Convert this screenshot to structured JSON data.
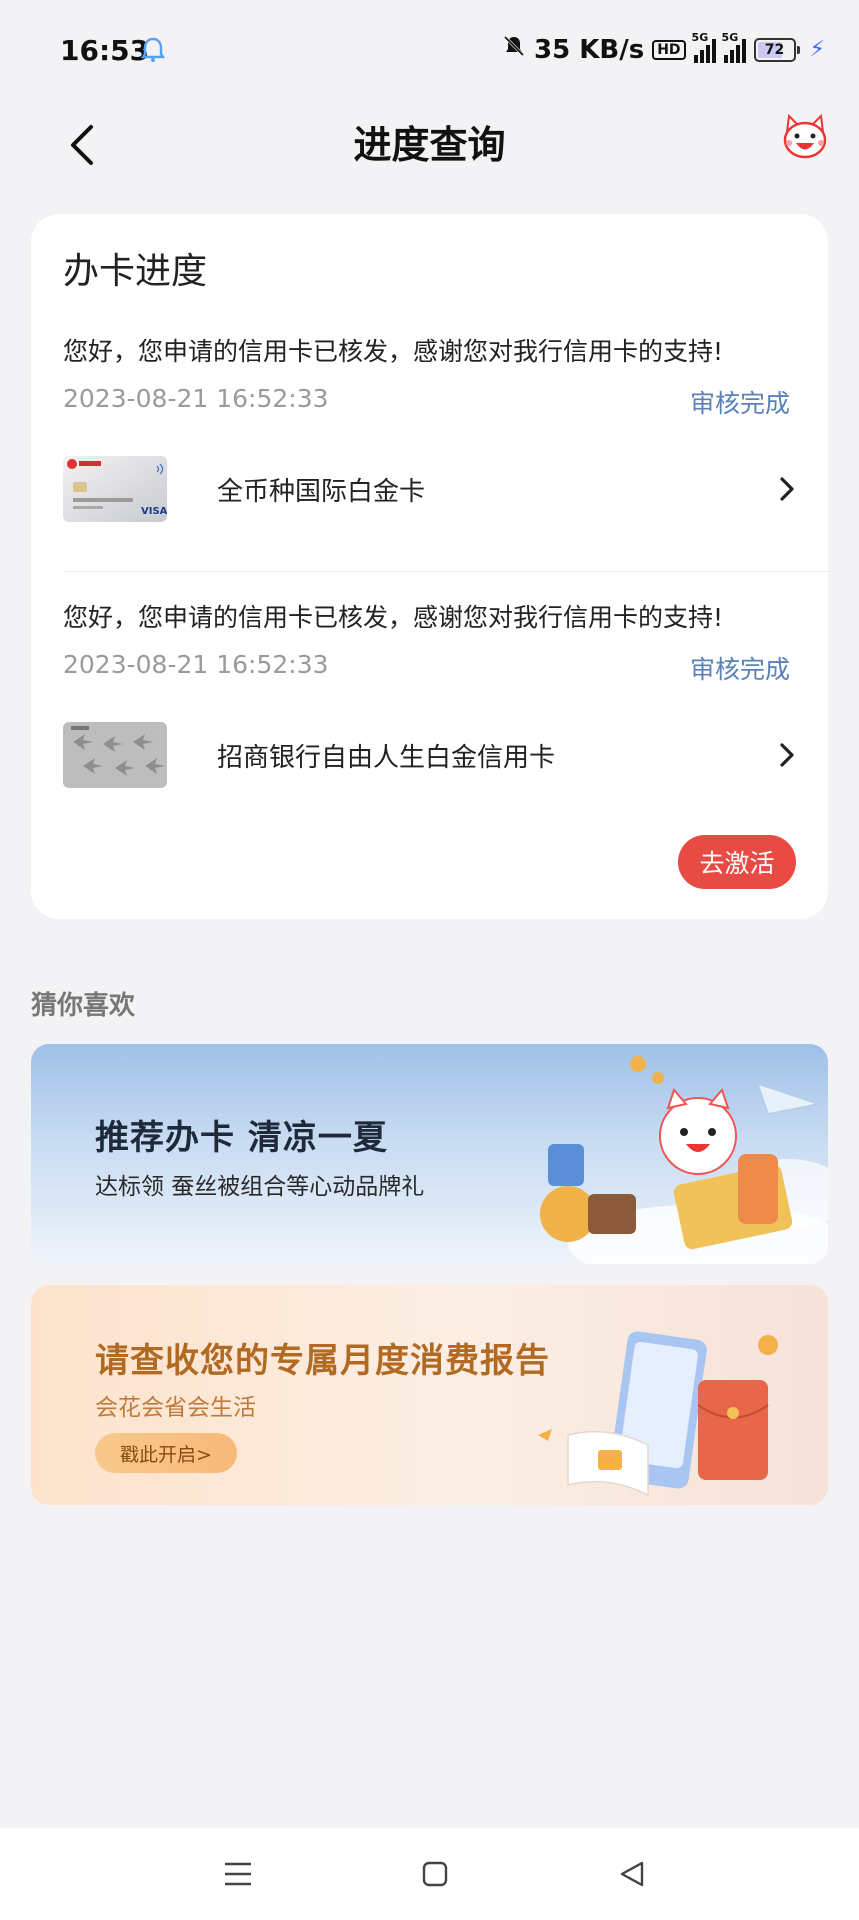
{
  "status_bar": {
    "time": "16:53",
    "net_speed": "35 KB/s",
    "hd_label": "HD",
    "sim1_label": "5G",
    "sim2_label": "5G",
    "battery": "72",
    "battery_level": 0.72,
    "icons": [
      "qq-bell-icon",
      "mute-icon",
      "signal-icon",
      "battery-icon",
      "charging-icon"
    ]
  },
  "header": {
    "title": "进度查询",
    "back_icon": "chevron-left-icon",
    "mascot_icon": "cat-mascot-icon"
  },
  "progress_card": {
    "title": "办卡进度",
    "applications": [
      {
        "message": "您好，您申请的信用卡已核发，感谢您对我行信用卡的支持!",
        "time": "2023-08-21 16:52:33",
        "status": "审核完成",
        "card_name": "全币种国际白金卡"
      },
      {
        "message": "您好，您申请的信用卡已核发，感谢您对我行信用卡的支持!",
        "time": "2023-08-21 16:52:33",
        "status": "审核完成",
        "card_name": "招商银行自由人生白金信用卡"
      }
    ],
    "activate_label": "去激活"
  },
  "recommend": {
    "section_title": "猜你喜欢",
    "banner1": {
      "title": "推荐办卡 清凉一夏",
      "subtitle": "达标领 蚕丝被组合等心动品牌礼"
    },
    "banner2": {
      "title": "请查收您的专属月度消费报告",
      "subtitle": "会花会省会生活",
      "button": "戳此开启>"
    }
  },
  "colors": {
    "accent_red": "#e84a44",
    "status_blue": "#5a82b8",
    "background": "#f3f3f5"
  }
}
